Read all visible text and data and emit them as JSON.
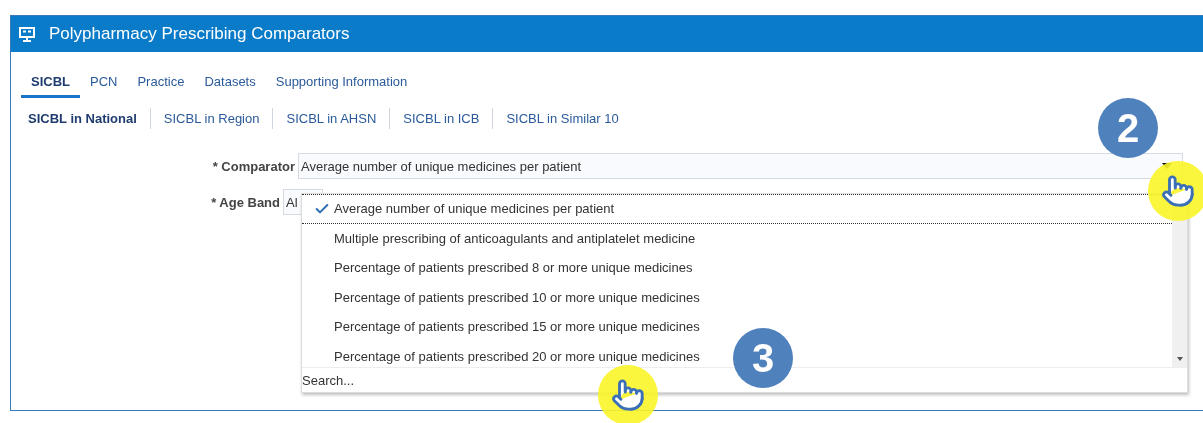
{
  "window": {
    "title": "Polypharmacy Prescribing Comparators"
  },
  "tabs": [
    {
      "label": "SICBL",
      "selected": true
    },
    {
      "label": "PCN",
      "selected": false
    },
    {
      "label": "Practice",
      "selected": false
    },
    {
      "label": "Datasets",
      "selected": false
    },
    {
      "label": "Supporting Information",
      "selected": false
    }
  ],
  "subtabs": [
    {
      "label": "SICBL in National",
      "selected": true
    },
    {
      "label": "SICBL in Region",
      "selected": false
    },
    {
      "label": "SICBL in AHSN",
      "selected": false
    },
    {
      "label": "SICBL in ICB",
      "selected": false
    },
    {
      "label": "SICBL in Similar 10",
      "selected": false
    }
  ],
  "fields": [
    {
      "label": "* Comparator",
      "value": "Average number of unique medicines per patient"
    },
    {
      "label": "* Age Band",
      "value": "Al"
    }
  ],
  "dropdown": {
    "options": [
      {
        "label": "Average number of unique medicines per patient",
        "selected": true
      },
      {
        "label": "Multiple prescribing of anticoagulants and antiplatelet medicine",
        "selected": false
      },
      {
        "label": "Percentage of patients prescribed 8 or more unique medicines",
        "selected": false
      },
      {
        "label": "Percentage of patients prescribed 10 or more unique medicines",
        "selected": false
      },
      {
        "label": "Percentage of patients prescribed 15 or more unique medicines",
        "selected": false
      },
      {
        "label": "Percentage of patients prescribed 20 or more unique medicines",
        "selected": false
      }
    ],
    "search": {
      "placeholder": "Search..."
    }
  },
  "callouts": [
    {
      "number": "2"
    },
    {
      "number": "3"
    }
  ]
}
